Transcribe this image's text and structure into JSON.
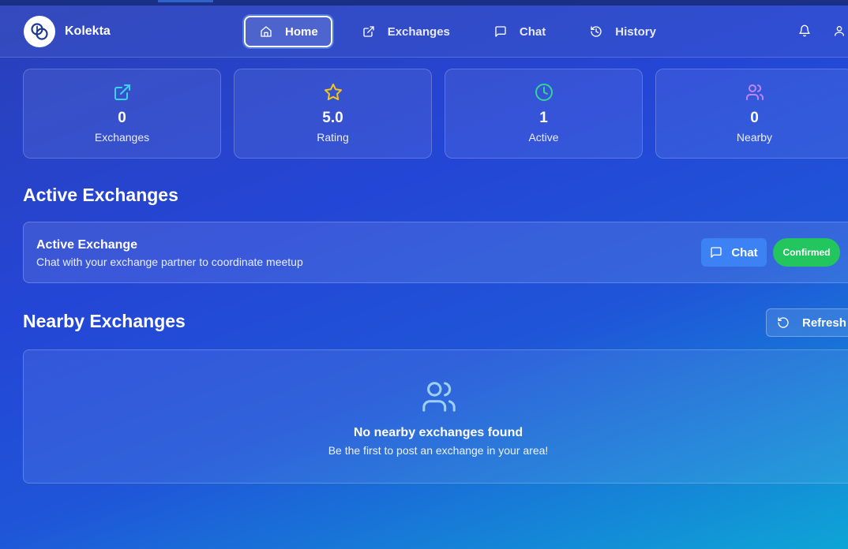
{
  "brand": {
    "name": "Kolekta"
  },
  "nav": {
    "home": "Home",
    "exchanges": "Exchanges",
    "chat": "Chat",
    "history": "History"
  },
  "stats": [
    {
      "icon": "external-link-icon",
      "value": "0",
      "label": "Exchanges",
      "color": "#38d3f5"
    },
    {
      "icon": "star-icon",
      "value": "5.0",
      "label": "Rating",
      "color": "#f5c518"
    },
    {
      "icon": "clock-icon",
      "value": "1",
      "label": "Active",
      "color": "#34d399"
    },
    {
      "icon": "users-icon",
      "value": "0",
      "label": "Nearby",
      "color": "#c084fc"
    }
  ],
  "active_section": {
    "heading": "Active Exchanges",
    "card": {
      "title": "Active Exchange",
      "subtitle": "Chat with your exchange partner to coordinate meetup",
      "chat_label": "Chat",
      "status": "Confirmed"
    }
  },
  "nearby_section": {
    "heading": "Nearby Exchanges",
    "refresh_label": "Refresh",
    "empty_title": "No nearby exchanges found",
    "empty_subtitle": "Be the first to post an exchange in your area!"
  }
}
